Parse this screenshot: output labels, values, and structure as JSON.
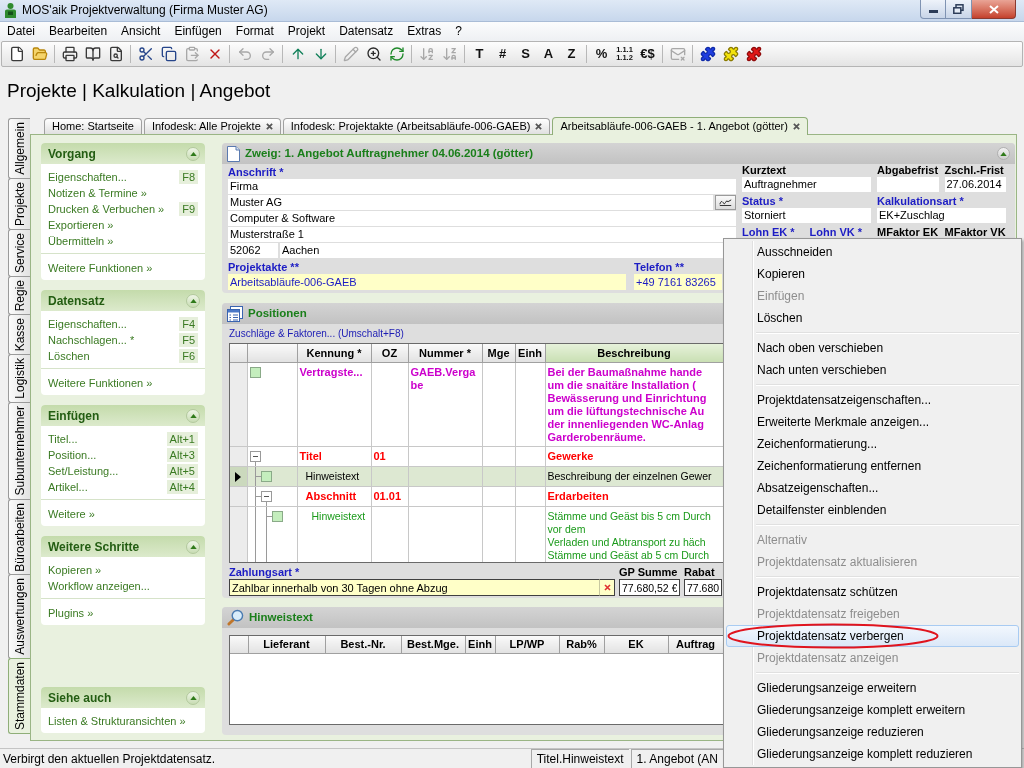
{
  "window": {
    "title": "MOS'aik Projektverwaltung (Firma Muster AG)"
  },
  "menu_bar": [
    "Datei",
    "Bearbeiten",
    "Ansicht",
    "Einfügen",
    "Format",
    "Projekt",
    "Datensatz",
    "Extras",
    "?"
  ],
  "toolbar": [
    [
      {
        "kind": "icon",
        "disabled": false
      },
      {
        "kind": "icon",
        "disabled": false
      }
    ],
    [
      {
        "kind": "icon",
        "disabled": false
      },
      {
        "kind": "icon",
        "disabled": false
      },
      {
        "kind": "icon",
        "disabled": false
      }
    ],
    [
      {
        "kind": "icon",
        "disabled": false
      },
      {
        "kind": "icon",
        "disabled": false
      },
      {
        "kind": "icon",
        "disabled": true
      },
      {
        "kind": "icon",
        "disabled": false
      }
    ],
    [
      {
        "kind": "icon",
        "disabled": true
      },
      {
        "kind": "icon",
        "disabled": true
      }
    ],
    [
      {
        "kind": "icon",
        "disabled": false
      },
      {
        "kind": "icon",
        "disabled": false
      }
    ],
    [
      {
        "kind": "icon",
        "disabled": true
      },
      {
        "kind": "icon",
        "disabled": false
      },
      {
        "kind": "icon",
        "disabled": false
      }
    ],
    [
      {
        "kind": "icon",
        "disabled": true
      },
      {
        "kind": "icon",
        "disabled": true
      }
    ],
    [
      {
        "kind": "text",
        "label": "T",
        "disabled": false
      },
      {
        "kind": "text",
        "label": "#",
        "disabled": false
      },
      {
        "kind": "text",
        "label": "S",
        "disabled": false
      },
      {
        "kind": "text",
        "label": "A",
        "disabled": false
      },
      {
        "kind": "text",
        "label": "Z",
        "disabled": false
      }
    ],
    [
      {
        "kind": "text",
        "label": "%",
        "disabled": false
      },
      {
        "kind": "stacked",
        "lines": [
          "1.1.1",
          "1.1.2"
        ],
        "disabled": false
      },
      {
        "kind": "text",
        "label": "€$",
        "disabled": false
      }
    ],
    [
      {
        "kind": "icon",
        "disabled": true
      }
    ],
    [
      {
        "kind": "icon",
        "disabled": false
      },
      {
        "kind": "icon",
        "disabled": false
      },
      {
        "kind": "icon",
        "disabled": false
      }
    ]
  ],
  "page_title": "Projekte | Kalkulation | Angebot",
  "tabs": [
    {
      "label": "Home: Startseite",
      "closable": false,
      "selected": false
    },
    {
      "label": "Infodesk: Alle Projekte",
      "closable": true,
      "selected": false
    },
    {
      "label": "Infodesk: Projektakte (Arbeitsabläufe-006-GAEB)",
      "closable": true,
      "selected": false
    },
    {
      "label": "Arbeitsabläufe-006-GAEB - 1. Angebot (götter)",
      "closable": true,
      "selected": true
    }
  ],
  "side_tabs": [
    {
      "label": "Allgemein",
      "selected": false
    },
    {
      "label": "Projekte",
      "selected": false
    },
    {
      "label": "Service",
      "selected": false
    },
    {
      "label": "Regie",
      "selected": false
    },
    {
      "label": "Kasse",
      "selected": false
    },
    {
      "label": "Logistik",
      "selected": false
    },
    {
      "label": "Subunternehmer",
      "selected": false
    },
    {
      "label": "Büroarbeiten",
      "selected": false
    },
    {
      "label": "Auswertungen",
      "selected": false
    },
    {
      "label": "Stammdaten",
      "selected": true
    }
  ],
  "side_panels": [
    {
      "title": "Vorgang",
      "expanded": true,
      "groups": [
        [
          {
            "label": "Eigenschaften...",
            "shortcut": "F8"
          },
          {
            "label": "Notizen & Termine »"
          },
          {
            "label": "Drucken & Verbuchen »",
            "shortcut": "F9"
          },
          {
            "label": "Exportieren »"
          },
          {
            "label": "Übermitteln »"
          }
        ],
        [
          {
            "label": "Weitere Funktionen »"
          }
        ]
      ]
    },
    {
      "title": "Datensatz",
      "expanded": true,
      "groups": [
        [
          {
            "label": "Eigenschaften...",
            "shortcut": "F4"
          },
          {
            "label": "Nachschlagen... *",
            "shortcut": "F5"
          },
          {
            "label": "Löschen",
            "shortcut": "F6"
          }
        ],
        [
          {
            "label": "Weitere Funktionen »"
          }
        ]
      ]
    },
    {
      "title": "Einfügen",
      "expanded": true,
      "groups": [
        [
          {
            "label": "Titel...",
            "shortcut": "Alt+1"
          },
          {
            "label": "Position...",
            "shortcut": "Alt+3"
          },
          {
            "label": "Set/Leistung...",
            "shortcut": "Alt+5"
          },
          {
            "label": "Artikel...",
            "shortcut": "Alt+4"
          }
        ],
        [
          {
            "label": "Weitere »"
          }
        ]
      ]
    },
    {
      "title": "Weitere Schritte",
      "expanded": true,
      "groups": [
        [
          {
            "label": "Kopieren »"
          },
          {
            "label": "Workflow anzeigen..."
          }
        ],
        [
          {
            "label": "Plugins »"
          }
        ]
      ]
    },
    {
      "title": "Siehe auch",
      "expanded": true,
      "groups": [
        [
          {
            "label": "Listen & Strukturansichten »"
          }
        ]
      ]
    }
  ],
  "details": {
    "title": "Zweig: 1. Angebot Auftragnehmer 04.06.2014 (götter)",
    "expanded": true,
    "address": {
      "label": "Anschrift *",
      "required": true,
      "lines": [
        {
          "value": "Firma",
          "button": false
        },
        {
          "value": "Muster AG",
          "button": true
        },
        {
          "value": "Computer & Software",
          "button": false
        },
        {
          "value": "Musterstraße 1",
          "button": false
        }
      ],
      "zip": "52062",
      "city": "Aachen"
    },
    "links": [
      {
        "label": "Projektakte **",
        "required": true,
        "value": "Arbeitsabläufe-006-GAEB"
      },
      {
        "label": "Telefon **",
        "required": true,
        "value": "+49 7161 83265"
      }
    ],
    "fields": [
      [
        {
          "kind": "input",
          "label": "Kurztext",
          "required": false,
          "value": "Auftragnehmer"
        },
        {
          "kind": "input",
          "label": "Abgabefrist",
          "required": false
        },
        {
          "kind": "input",
          "label": "Zschl.-Frist",
          "required": false,
          "value": "27.06.2014"
        }
      ],
      [
        {
          "kind": "input",
          "label": "Status *",
          "required": true,
          "value": "Storniert"
        },
        {
          "kind": "input",
          "label": "Kalkulationsart *",
          "required": true,
          "value": "EK+Zuschlag"
        }
      ],
      [
        {
          "kind": "label",
          "label": "Lohn EK *",
          "required": true
        },
        {
          "kind": "label",
          "label": "Lohn VK *",
          "required": true
        },
        {
          "kind": "label",
          "label": "MFaktor EK",
          "required": false
        },
        {
          "kind": "label",
          "label": "MFaktor VK",
          "required": false
        }
      ]
    ]
  },
  "positions": {
    "title": "Positionen",
    "link": "Zuschläge & Faktoren... (Umschalt+F8)",
    "columns": [
      {
        "label": "Kennung *",
        "highlighted": false
      },
      {
        "label": "OZ",
        "highlighted": false
      },
      {
        "label": "Nummer *",
        "highlighted": false
      },
      {
        "label": "Mge",
        "highlighted": false
      },
      {
        "label": "Einh",
        "highlighted": false
      },
      {
        "label": "Beschreibung",
        "highlighted": true
      }
    ],
    "rows": [
      {
        "kind": "heading",
        "selected": false,
        "color": "#cc00cc",
        "kennung": "Vertragste...",
        "nummer": "GAEB.Vergabe",
        "description": [
          "Bei der Baumaßnahme hande",
          "um die snaitäre Installation (",
          "Bewässerung und Einrichtung",
          "um die lüftungstechnische Au",
          "der innenliegenden WC-Anlag",
          "Garderobenräume."
        ]
      },
      {
        "kind": "heading",
        "selected": false,
        "expanded": true,
        "color": "#ff0000",
        "kennung": "Titel",
        "oz": "01",
        "description": [
          "Gewerke"
        ],
        "children": [
          {
            "kind": "text",
            "selected": true,
            "color": "#000000",
            "kennung": "Hinweistext",
            "description": [
              "Beschreibung der einzelnen Gewer"
            ]
          },
          {
            "kind": "heading",
            "selected": false,
            "expanded": true,
            "color": "#ff0000",
            "kennung": "Abschnitt",
            "oz": "01.01",
            "description": [
              "Erdarbeiten"
            ],
            "children": [
              {
                "kind": "text",
                "selected": false,
                "color": "#1a9a1a",
                "kennung": "Hinweistext",
                "description": [
                  "Stämme und Geäst bis 5 cm Durch",
                  "vor dem",
                  "Verladen und Abtransport zu häch",
                  "Stämme und Geäst ab 5 cm Durch"
                ]
              }
            ]
          }
        ]
      }
    ],
    "payment": {
      "label": "Zahlungsart *",
      "required": true,
      "value": "Zahlbar innerhalb von 30 Tagen ohne Abzug",
      "clearable": true
    },
    "totals": [
      {
        "label": "GP Summe",
        "required": false,
        "value": "77.680,52 €"
      },
      {
        "label": "Rabat",
        "required": false,
        "value": "77.680"
      }
    ]
  },
  "notes": {
    "title": "Hinweistext",
    "columns": [
      "Lieferant",
      "Best.-Nr.",
      "Best.Mge.",
      "Einh",
      "LP/WP",
      "Rab%",
      "EK",
      "Auftrag"
    ]
  },
  "status_bar": {
    "message": "Verbirgt den aktuellen Projektdatensatz.",
    "panels": [
      "Titel.Hinweistext",
      "1. Angebot (AN"
    ]
  },
  "context_menu": {
    "groups": [
      [
        {
          "label": "Ausschneiden",
          "disabled": false,
          "selected": false,
          "circled": false
        },
        {
          "label": "Kopieren",
          "disabled": false,
          "selected": false,
          "circled": false
        },
        {
          "label": "Einfügen",
          "disabled": true,
          "selected": false,
          "circled": false
        },
        {
          "label": "Löschen",
          "disabled": false,
          "selected": false,
          "circled": false
        }
      ],
      [
        {
          "label": "Nach oben verschieben",
          "disabled": false,
          "selected": false,
          "circled": false
        },
        {
          "label": "Nach unten verschieben",
          "disabled": false,
          "selected": false,
          "circled": false
        }
      ],
      [
        {
          "label": "Projektdatensatzeigenschaften...",
          "disabled": false,
          "selected": false,
          "circled": false
        },
        {
          "label": "Erweiterte Merkmale anzeigen...",
          "disabled": false,
          "selected": false,
          "circled": false
        },
        {
          "label": "Zeichenformatierung...",
          "disabled": false,
          "selected": false,
          "circled": false
        },
        {
          "label": "Zeichenformatierung entfernen",
          "disabled": false,
          "selected": false,
          "circled": false
        },
        {
          "label": "Absatzeigenschaften...",
          "disabled": false,
          "selected": false,
          "circled": false
        },
        {
          "label": "Detailfenster einblenden",
          "disabled": false,
          "selected": false,
          "circled": false
        }
      ],
      [
        {
          "label": "Alternativ",
          "disabled": true,
          "selected": false,
          "circled": false
        },
        {
          "label": "Projektdatensatz aktualisieren",
          "disabled": true,
          "selected": false,
          "circled": false
        }
      ],
      [
        {
          "label": "Projektdatensatz schützen",
          "disabled": false,
          "selected": false,
          "circled": false
        },
        {
          "label": "Projektdatensatz freigeben",
          "disabled": true,
          "selected": false,
          "circled": false
        },
        {
          "label": "Projektdatensatz verbergen",
          "disabled": false,
          "selected": true,
          "circled": true
        },
        {
          "label": "Projektdatensatz anzeigen",
          "disabled": true,
          "selected": false,
          "circled": false
        }
      ],
      [
        {
          "label": "Gliederungsanzeige erweitern",
          "disabled": false,
          "selected": false,
          "circled": false
        },
        {
          "label": "Gliederungsanzeige komplett erweitern",
          "disabled": false,
          "selected": false,
          "circled": false
        },
        {
          "label": "Gliederungsanzeige reduzieren",
          "disabled": false,
          "selected": false,
          "circled": false
        },
        {
          "label": "Gliederungsanzeige komplett reduzieren",
          "disabled": false,
          "selected": false,
          "circled": false
        }
      ]
    ]
  }
}
